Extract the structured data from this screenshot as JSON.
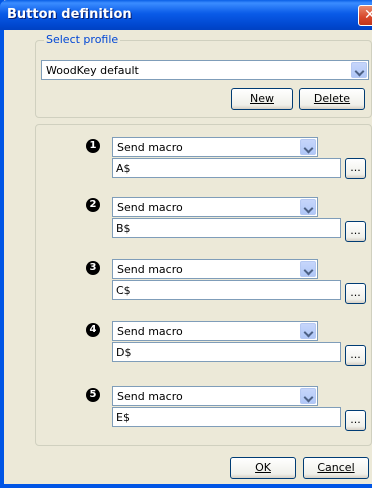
{
  "window": {
    "title": "Button definition"
  },
  "profile": {
    "group_label": "Select profile",
    "selected": "WoodKey default",
    "new_label": "New",
    "delete_label": "Delete"
  },
  "buttons": [
    {
      "number": "1",
      "action": "Send macro",
      "macro": "A$",
      "browse_label": "..."
    },
    {
      "number": "2",
      "action": "Send macro",
      "macro": "B$",
      "browse_label": "..."
    },
    {
      "number": "3",
      "action": "Send macro",
      "macro": "C$",
      "browse_label": "..."
    },
    {
      "number": "4",
      "action": "Send macro",
      "macro": "D$",
      "browse_label": "..."
    },
    {
      "number": "5",
      "action": "Send macro",
      "macro": "E$",
      "browse_label": "..."
    }
  ],
  "footer": {
    "ok_label": "OK",
    "cancel_label": "Cancel"
  },
  "colors": {
    "titlebar": "#0055e5",
    "dialog_bg": "#ece9d8",
    "group_label": "#0046d5",
    "close": "#d7462a"
  }
}
